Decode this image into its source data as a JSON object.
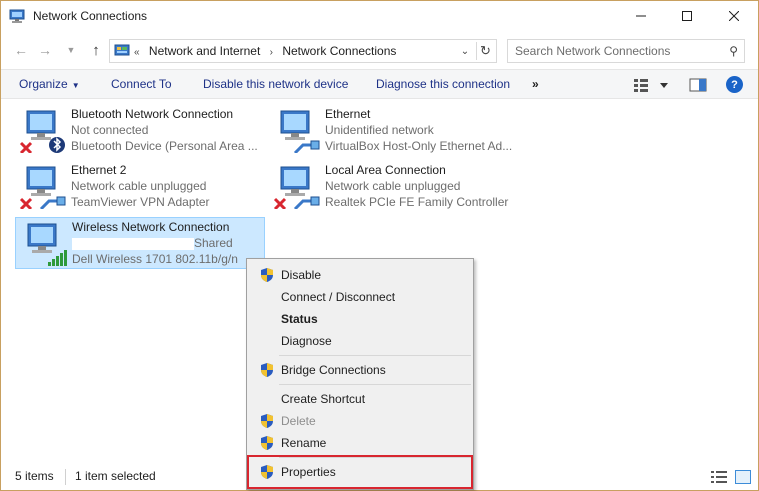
{
  "window": {
    "title": "Network Connections"
  },
  "address": {
    "crumbs": [
      "«",
      "Network and Internet",
      "›",
      "Network Connections"
    ],
    "search_placeholder": "Search Network Connections"
  },
  "toolbar": {
    "organize": "Organize",
    "connect_to": "Connect To",
    "disable_device": "Disable this network device",
    "diagnose": "Diagnose this connection",
    "more": "»",
    "help": "?"
  },
  "connections": [
    {
      "name": "Bluetooth Network Connection",
      "status": "Not connected",
      "device": "Bluetooth Device (Personal Area ...",
      "icon": "bluetooth-network-icon",
      "overlay": "red-x"
    },
    {
      "name": "Ethernet",
      "status": "Unidentified network",
      "device": "VirtualBox Host-Only Ethernet Ad...",
      "icon": "ethernet-network-icon",
      "overlay": "cable"
    },
    {
      "name": "Ethernet 2",
      "status": "Network cable unplugged",
      "device": "TeamViewer VPN Adapter",
      "icon": "ethernet-network-icon",
      "overlay": "red-x"
    },
    {
      "name": "Local Area Connection",
      "status": "Network cable unplugged",
      "device": "Realtek PCIe FE Family Controller",
      "icon": "ethernet-network-icon",
      "overlay": "red-x"
    },
    {
      "name": "Wireless Network Connection",
      "status": "Shared",
      "device": "Dell Wireless 1701 802.11b/g/n",
      "icon": "wireless-network-icon",
      "overlay": "signal-bars",
      "selected": true
    }
  ],
  "context_menu": {
    "disable": "Disable",
    "connect_disconnect": "Connect / Disconnect",
    "status": "Status",
    "diagnose": "Diagnose",
    "bridge": "Bridge Connections",
    "create_shortcut": "Create Shortcut",
    "delete": "Delete",
    "rename": "Rename",
    "properties": "Properties"
  },
  "statusbar": {
    "count": "5 items",
    "selected": "1 item selected"
  },
  "colors": {
    "accent": "#1e3287",
    "selection": "#cce8ff",
    "highlight_box": "#d8262f"
  }
}
